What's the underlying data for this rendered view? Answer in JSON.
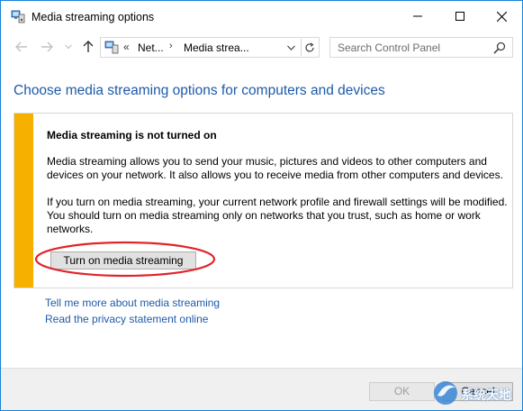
{
  "window": {
    "title": "Media streaming options",
    "controls": {
      "minimize": "minimize-icon",
      "maximize": "maximize-icon",
      "close": "close-icon"
    }
  },
  "address_bar": {
    "chevron": "«",
    "segments": [
      "Net...",
      "Media strea..."
    ],
    "separator": "›"
  },
  "search": {
    "placeholder": "Search Control Panel"
  },
  "main": {
    "heading": "Choose media streaming options for computers and devices",
    "panel": {
      "accent_color": "#f5b000",
      "title": "Media streaming is not turned on",
      "paragraph1": "Media streaming allows you to send your music, pictures and videos to other computers and devices on your network.  It also allows you to receive media from other computers and devices.",
      "paragraph2": "If you turn on media streaming, your current network profile and firewall settings will be modified.  You should turn on media streaming only on networks that you trust, such as home or work networks.",
      "button_label": "Turn on media streaming",
      "highlight_color": "#e0242b"
    },
    "links": [
      "Tell me more about media streaming",
      "Read the privacy statement online"
    ]
  },
  "footer": {
    "ok_label": "OK",
    "cancel_label": "Cancel"
  },
  "watermark": {
    "text": "系统天地"
  }
}
